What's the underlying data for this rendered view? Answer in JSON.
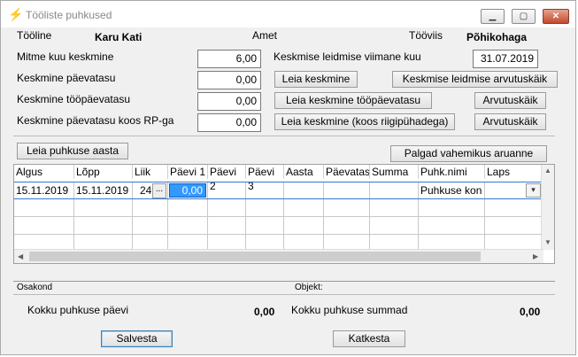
{
  "window": {
    "title": "Tööliste puhkused"
  },
  "header": {
    "tooline_label": "Tööline",
    "tooline_value": "Karu Kati",
    "amet_label": "Amet",
    "tooviis_label": "Tööviis",
    "tooviis_value": "Põhikohaga"
  },
  "fields": {
    "mitme_kuu_label": "Mitme kuu keskmine",
    "mitme_kuu_value": "6,00",
    "viimane_kuu_label": "Keskmise leidmise viimane kuu",
    "viimane_kuu_value": "31.07.2019",
    "paevatasu_label": "Keskmine päevatasu",
    "paevatasu_value": "0,00",
    "toopaevatasu_label": "Keskmine tööpäevatasu",
    "toopaevatasu_value": "0,00",
    "rp_label": "Keskmine päevatasu koos RP-ga",
    "rp_value": "0,00"
  },
  "buttons": {
    "leia_keskmine": "Leia keskmine",
    "keskmise_arvutuskaik": "Keskmise leidmise arvutuskäik",
    "leia_toopaevatasu": "Leia keskmine tööpäevatasu",
    "arvutuskaik1": "Arvutuskäik",
    "leia_riigipuha": "Leia keskmine (koos riigipühadega)",
    "arvutuskaik2": "Arvutuskäik",
    "leia_puhkuse_aasta": "Leia puhkuse aasta",
    "palgad_aruanne": "Palgad vahemikus aruanne",
    "salvesta": "Salvesta",
    "katkesta": "Katkesta"
  },
  "grid": {
    "columns": [
      "Algus",
      "Lõpp",
      "Liik",
      "Päevi 1",
      "Päevi 2",
      "Päevi 3",
      "Aasta",
      "Päevatasu",
      "Summa",
      "Puhk.nimi",
      "Laps"
    ],
    "row": {
      "algus": "15.11.2019",
      "lopp": "15.11.2019",
      "liik": "24",
      "ellipsis": "...",
      "paevi1": "0,00",
      "puhk_nimi": "Puhkuse kon"
    }
  },
  "footer": {
    "osakond_label": "Osakond",
    "objekt_label": "Objekt:",
    "kokku_paevi_label": "Kokku puhkuse päevi",
    "kokku_paevi_value": "0,00",
    "kokku_summad_label": "Kokku puhkuse summad",
    "kokku_summad_value": "0,00"
  },
  "colors": {
    "accent": "#3399ff",
    "title_icon": "#e8a317"
  },
  "icons": {
    "app": "lightning-app-icon",
    "minimize": "minimize-icon",
    "maximize": "maximize-icon",
    "close": "close-icon",
    "dropdown": "chevron-down-icon"
  }
}
